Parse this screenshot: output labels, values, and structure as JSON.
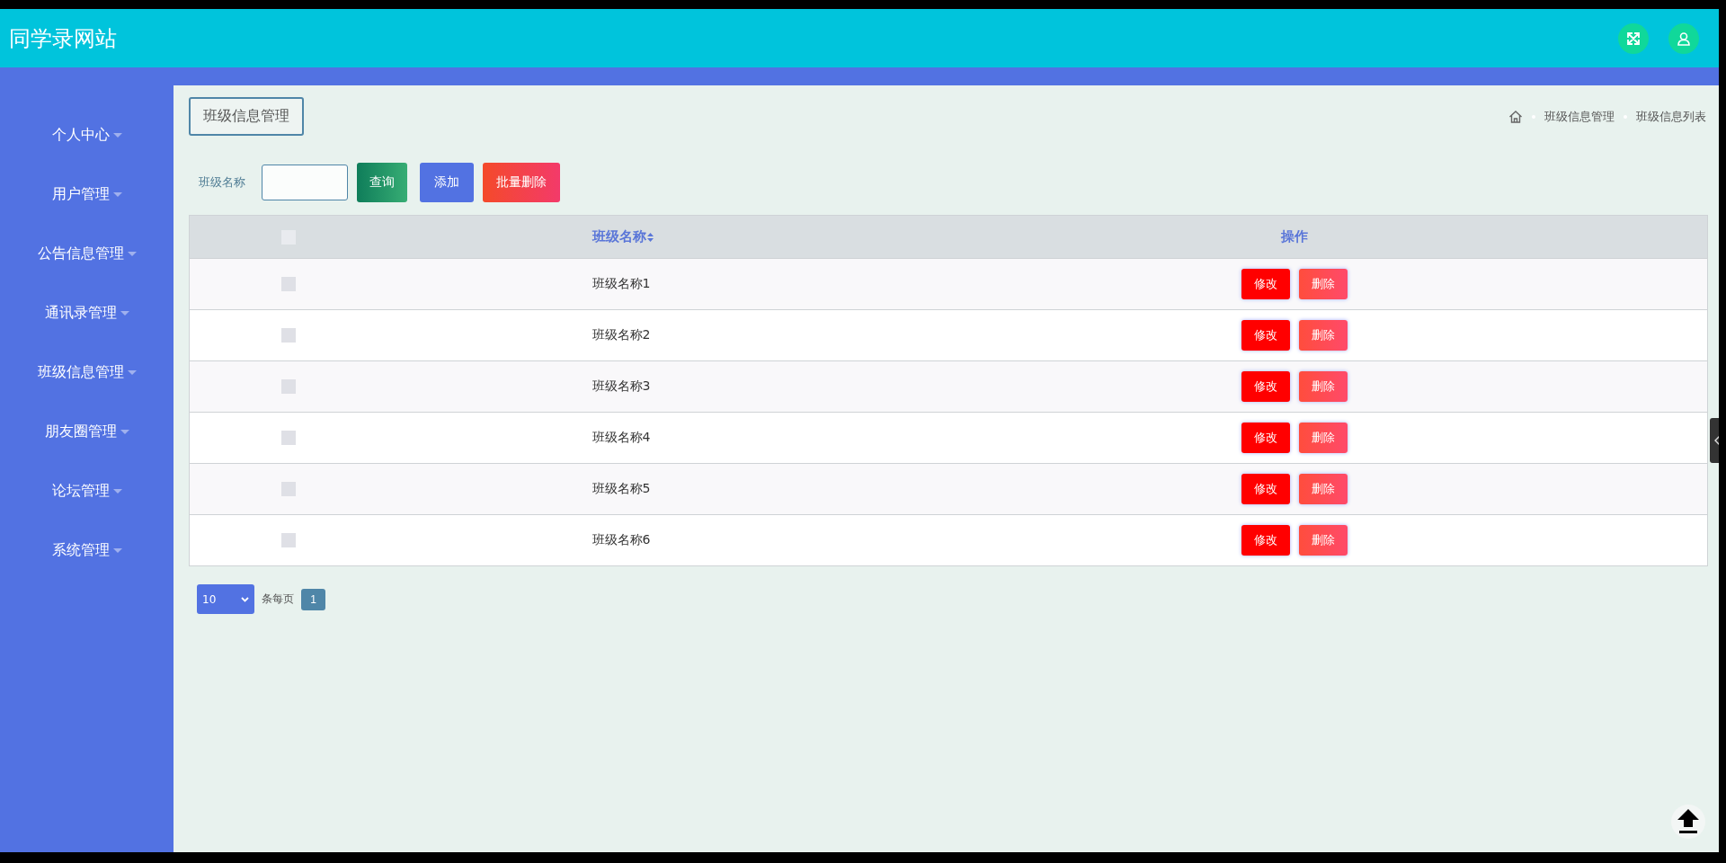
{
  "header": {
    "title": "同学录网站"
  },
  "sidebar": {
    "items": [
      {
        "label": "个人中心"
      },
      {
        "label": "用户管理"
      },
      {
        "label": "公告信息管理"
      },
      {
        "label": "通讯录管理"
      },
      {
        "label": "班级信息管理"
      },
      {
        "label": "朋友圈管理"
      },
      {
        "label": "论坛管理"
      },
      {
        "label": "系统管理"
      }
    ]
  },
  "page_title": "班级信息管理",
  "breadcrumb": [
    "班级信息管理",
    "班级信息列表"
  ],
  "search": {
    "label": "班级名称",
    "buttons": [
      {
        "label": "查询",
        "kind": "search"
      },
      {
        "label": "添加",
        "kind": "add"
      },
      {
        "label": "批量删除",
        "kind": "delete"
      }
    ]
  },
  "table": {
    "select_all_checked": false,
    "columns": [
      "班级名称",
      "操作"
    ],
    "rows": [
      {
        "checked": false,
        "name": "班级名称1",
        "actions": [
          "修改",
          "删除"
        ]
      },
      {
        "checked": false,
        "name": "班级名称2",
        "actions": [
          "修改",
          "删除"
        ]
      },
      {
        "checked": false,
        "name": "班级名称3",
        "actions": [
          "修改",
          "删除"
        ]
      },
      {
        "checked": false,
        "name": "班级名称4",
        "actions": [
          "修改",
          "删除"
        ]
      },
      {
        "checked": false,
        "name": "班级名称5",
        "actions": [
          "修改",
          "删除"
        ]
      },
      {
        "checked": false,
        "name": "班级名称6",
        "actions": [
          "修改",
          "删除"
        ]
      }
    ]
  },
  "pagination": {
    "page_size": "10",
    "per_page_label": "条每页",
    "pages": [
      {
        "label": "1",
        "selected": true
      }
    ]
  }
}
